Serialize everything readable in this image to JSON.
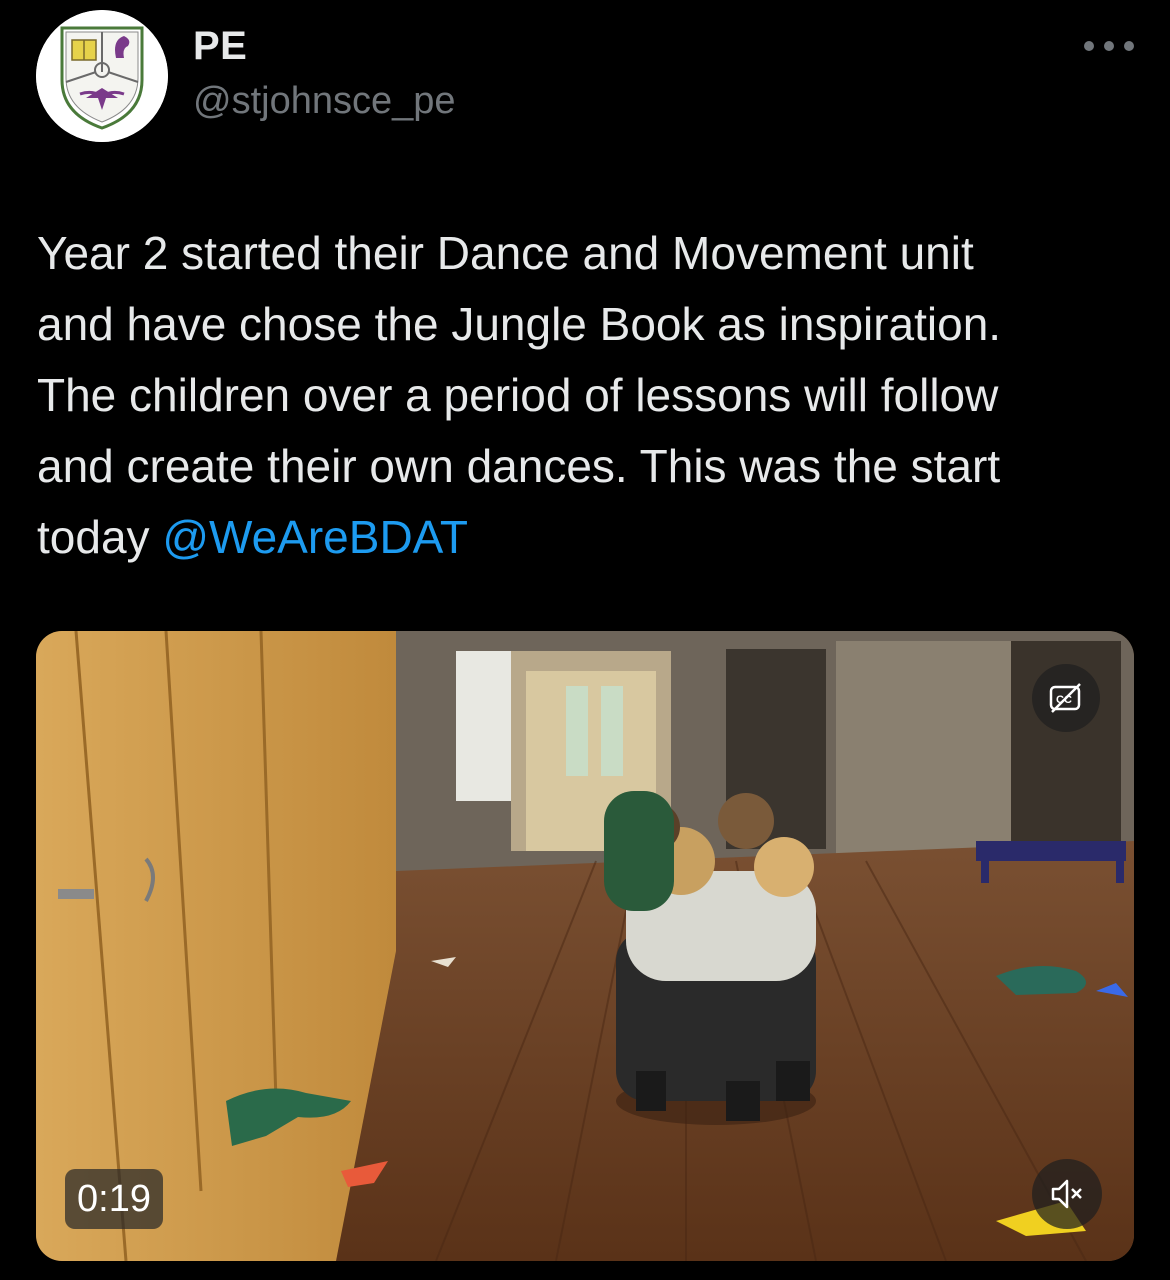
{
  "author": {
    "display_name": "PE",
    "handle": "@stjohnsce_pe",
    "avatar_icon": "school-crest-icon"
  },
  "tweet": {
    "text_lines": [
      "Year 2 started their Dance and Movement unit",
      "and have chose the Jungle Book as inspiration.",
      "The children over a period of lessons will follow",
      "and create their own dances. This was the start",
      "today "
    ],
    "mention": "@WeAreBDAT"
  },
  "media": {
    "type": "video",
    "duration": "0:19",
    "captions_icon": "closed-captions-off-icon",
    "mute_icon": "speaker-muted-icon"
  },
  "colors": {
    "background": "#000000",
    "text": "#e7e9ea",
    "secondary_text": "#71767b",
    "mention": "#1d9bf0"
  }
}
